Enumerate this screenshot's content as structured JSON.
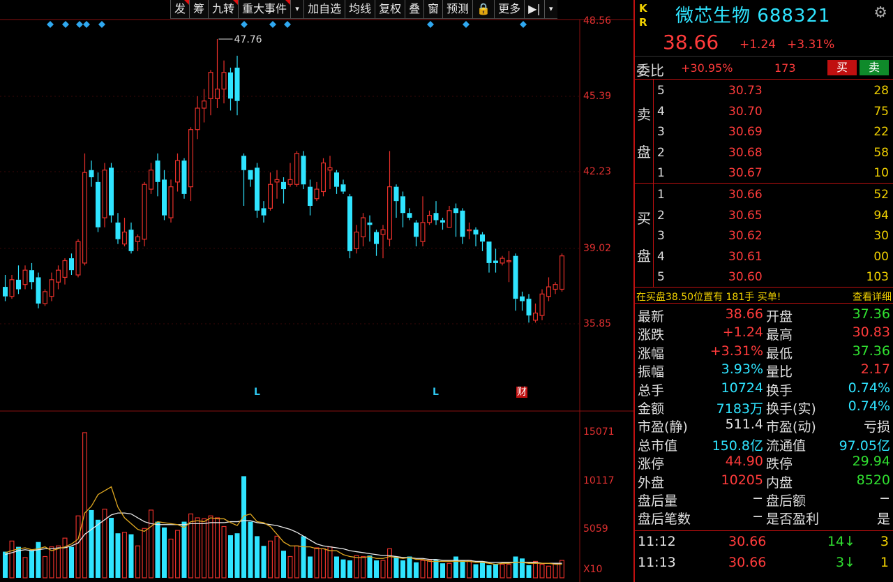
{
  "toolbar": {
    "items": [
      "发",
      "筹",
      "九转",
      "重大事件",
      "▾",
      "加自选",
      "均线",
      "复权",
      "叠",
      "窗",
      "预测",
      "🔒",
      "更多",
      "▶|",
      "▾"
    ]
  },
  "price_axis": [
    "48.56",
    "45.39",
    "42.23",
    "39.02",
    "35.85"
  ],
  "volume_axis": [
    "15071",
    "10117",
    "5059",
    "X10"
  ],
  "high_marker": "47.76",
  "event_marks": {
    "l1": "L",
    "l2": "L",
    "cai": "财"
  },
  "colors": {
    "up": "#e8302a",
    "down": "#2fe4ff",
    "ma_white": "#e8e8e8",
    "ma_yellow": "#e0a820",
    "grid": "#8a1010"
  },
  "chart_data": {
    "type": "candlestick",
    "candles": [
      [
        37.4,
        37.0,
        37.9,
        36.8
      ],
      [
        37.0,
        37.7,
        37.9,
        36.9
      ],
      [
        37.7,
        37.3,
        38.3,
        37.1
      ],
      [
        37.5,
        38.1,
        38.3,
        37.3
      ],
      [
        38.1,
        37.6,
        38.4,
        37.3
      ],
      [
        37.8,
        36.7,
        38.0,
        36.5
      ],
      [
        36.7,
        37.2,
        37.3,
        36.6
      ],
      [
        37.0,
        37.7,
        38.0,
        36.8
      ],
      [
        37.6,
        38.1,
        38.3,
        37.3
      ],
      [
        37.8,
        38.5,
        38.6,
        37.5
      ],
      [
        38.6,
        38.1,
        38.8,
        37.9
      ],
      [
        37.9,
        39.3,
        39.4,
        37.8
      ],
      [
        38.4,
        42.2,
        43.0,
        38.3
      ],
      [
        42.3,
        42.0,
        42.7,
        41.6
      ],
      [
        41.8,
        39.9,
        42.2,
        39.7
      ],
      [
        40.3,
        42.3,
        42.6,
        39.9
      ],
      [
        42.4,
        40.4,
        42.6,
        40.1
      ],
      [
        40.1,
        39.4,
        40.5,
        39.2
      ],
      [
        39.2,
        39.7,
        40.3,
        39.1
      ],
      [
        39.8,
        38.9,
        40.1,
        38.8
      ],
      [
        39.3,
        39.5,
        39.6,
        38.9
      ],
      [
        39.4,
        41.7,
        41.8,
        39.1
      ],
      [
        41.5,
        42.3,
        42.6,
        41.3
      ],
      [
        42.7,
        41.8,
        43.0,
        41.2
      ],
      [
        41.9,
        40.4,
        42.3,
        40.2
      ],
      [
        40.3,
        41.6,
        41.9,
        40.1
      ],
      [
        41.8,
        42.7,
        43.0,
        41.4
      ],
      [
        42.7,
        41.3,
        42.8,
        41.1
      ],
      [
        41.6,
        44.0,
        44.1,
        41.0
      ],
      [
        44.0,
        44.9,
        45.4,
        43.6
      ],
      [
        44.9,
        45.2,
        45.7,
        44.3
      ],
      [
        45.3,
        46.4,
        46.5,
        44.6
      ],
      [
        45.3,
        45.7,
        47.8,
        44.9
      ],
      [
        45.7,
        46.4,
        46.9,
        45.1
      ],
      [
        46.4,
        45.3,
        46.6,
        44.8
      ],
      [
        46.6,
        45.2,
        47.1,
        44.6
      ],
      [
        42.9,
        42.3,
        43.0,
        40.8
      ],
      [
        42.3,
        41.9,
        42.3,
        41.6
      ],
      [
        42.4,
        40.6,
        42.6,
        40.3
      ],
      [
        40.7,
        40.4,
        41.0,
        40.1
      ],
      [
        40.7,
        41.7,
        42.2,
        40.6
      ],
      [
        41.8,
        41.9,
        42.3,
        41.1
      ],
      [
        41.8,
        41.5,
        42.0,
        40.9
      ],
      [
        41.7,
        41.9,
        42.6,
        41.6
      ],
      [
        41.7,
        43.0,
        43.1,
        41.6
      ],
      [
        42.9,
        41.7,
        43.1,
        41.5
      ],
      [
        41.6,
        40.8,
        41.9,
        40.4
      ],
      [
        41.1,
        41.5,
        41.8,
        41.0
      ],
      [
        41.4,
        42.6,
        42.8,
        41.2
      ],
      [
        42.3,
        42.4,
        42.9,
        41.5
      ],
      [
        42.2,
        41.6,
        42.3,
        41.3
      ],
      [
        41.7,
        41.4,
        41.9,
        41.3
      ],
      [
        41.2,
        38.9,
        41.3,
        38.6
      ],
      [
        39.0,
        39.7,
        40.0,
        38.8
      ],
      [
        39.5,
        40.3,
        40.5,
        39.1
      ],
      [
        40.1,
        40.0,
        40.4,
        39.3
      ],
      [
        39.7,
        39.2,
        39.8,
        38.7
      ],
      [
        39.6,
        39.8,
        40.0,
        38.6
      ],
      [
        39.4,
        41.6,
        43.1,
        39.1
      ],
      [
        41.6,
        41.0,
        41.7,
        40.3
      ],
      [
        41.2,
        40.5,
        41.4,
        39.9
      ],
      [
        40.5,
        40.3,
        40.7,
        40.2
      ],
      [
        40.1,
        39.5,
        40.2,
        39.1
      ],
      [
        39.3,
        40.1,
        41.2,
        39.1
      ],
      [
        40.1,
        40.4,
        40.6,
        40.0
      ],
      [
        40.5,
        40.2,
        41.0,
        40.0
      ],
      [
        40.2,
        40.1,
        40.3,
        39.8
      ],
      [
        39.9,
        40.6,
        40.8,
        39.9
      ],
      [
        40.7,
        40.5,
        40.9,
        39.5
      ],
      [
        40.6,
        39.5,
        40.7,
        39.2
      ],
      [
        39.8,
        39.8,
        40.1,
        39.4
      ],
      [
        39.8,
        39.6,
        39.9,
        39.1
      ],
      [
        39.6,
        39.3,
        39.7,
        38.9
      ],
      [
        39.3,
        38.4,
        39.3,
        38.0
      ],
      [
        38.5,
        38.4,
        39.0,
        38.0
      ],
      [
        38.4,
        38.6,
        38.7,
        38.3
      ],
      [
        38.5,
        38.5,
        38.9,
        37.6
      ],
      [
        38.7,
        36.9,
        38.8,
        36.4
      ],
      [
        37.0,
        36.8,
        37.2,
        36.4
      ],
      [
        36.9,
        36.2,
        37.1,
        35.9
      ],
      [
        36.0,
        36.3,
        36.7,
        35.9
      ],
      [
        36.2,
        37.1,
        37.3,
        36.0
      ],
      [
        37.0,
        37.4,
        37.8,
        36.8
      ],
      [
        37.3,
        37.5,
        37.6,
        37.1
      ],
      [
        37.3,
        38.7,
        38.8,
        37.2
      ]
    ],
    "volumes": [
      27,
      38,
      32,
      21,
      28,
      37,
      22,
      32,
      33,
      41,
      32,
      64,
      150,
      70,
      60,
      71,
      62,
      46,
      47,
      45,
      33,
      51,
      70,
      58,
      52,
      40,
      49,
      58,
      66,
      62,
      61,
      64,
      62,
      53,
      44,
      46,
      105,
      58,
      43,
      33,
      38,
      43,
      28,
      22,
      33,
      43,
      22,
      31,
      30,
      32,
      22,
      19,
      18,
      23,
      22,
      23,
      18,
      18,
      30,
      22,
      18,
      22,
      16,
      18,
      18,
      19,
      15,
      15,
      22,
      18,
      18,
      14,
      17,
      13,
      14,
      14,
      14,
      22,
      20,
      13,
      17,
      14,
      12,
      15,
      18
    ],
    "ma5": [
      26,
      28,
      30,
      31,
      29,
      30,
      32,
      28,
      30,
      32,
      35,
      40,
      67,
      74,
      86,
      90,
      94,
      73,
      62,
      56,
      50,
      48,
      53,
      58,
      57,
      56,
      55,
      52,
      58,
      59,
      58,
      62,
      61,
      61,
      57,
      54,
      64,
      66,
      58,
      57,
      53,
      45,
      37,
      33,
      33,
      32,
      32,
      30,
      30,
      28,
      28,
      24,
      22,
      21,
      21,
      22,
      20,
      20,
      22,
      21,
      20,
      21,
      19,
      19,
      17,
      17,
      17,
      17,
      17,
      17,
      17,
      16,
      16,
      15,
      14,
      15,
      15,
      16,
      16,
      15,
      15,
      15,
      15,
      14,
      14
    ],
    "ma10": [
      24,
      26,
      28,
      29,
      28,
      29,
      30,
      30,
      31,
      31,
      33,
      36,
      45,
      50,
      55,
      60,
      65,
      67,
      67,
      66,
      62,
      58,
      56,
      55,
      55,
      55,
      55,
      55,
      56,
      56,
      56,
      57,
      57,
      57,
      58,
      58,
      59,
      59,
      57,
      56,
      55,
      54,
      52,
      50,
      47,
      43,
      39,
      35,
      33,
      32,
      31,
      30,
      28,
      27,
      26,
      25,
      24,
      23,
      23,
      22,
      21,
      21,
      20,
      20,
      19,
      19,
      18,
      18,
      18,
      18,
      18,
      17,
      17,
      16,
      16,
      16,
      16,
      16,
      16,
      16,
      16,
      15,
      15,
      15,
      15
    ]
  },
  "stock": {
    "kr": "K\nR",
    "name": "微芯生物",
    "code": "688321",
    "price": "38.66",
    "change": "+1.24",
    "change_pct": "+3.31%"
  },
  "weibi": {
    "label": "委比",
    "pct": "+30.95%",
    "num": "173",
    "buy": "买",
    "sell": "卖"
  },
  "orderbook": {
    "sell_label": [
      "卖",
      "盘"
    ],
    "buy_label": [
      "买",
      "盘"
    ],
    "sell": [
      {
        "lvl": "5",
        "price": "30.73",
        "qty": "28"
      },
      {
        "lvl": "4",
        "price": "30.70",
        "qty": "75"
      },
      {
        "lvl": "3",
        "price": "30.69",
        "qty": "22"
      },
      {
        "lvl": "2",
        "price": "30.68",
        "qty": "58"
      },
      {
        "lvl": "1",
        "price": "30.67",
        "qty": "10"
      }
    ],
    "buy": [
      {
        "lvl": "1",
        "price": "30.66",
        "qty": "52"
      },
      {
        "lvl": "2",
        "price": "30.65",
        "qty": "94"
      },
      {
        "lvl": "3",
        "price": "30.62",
        "qty": "30"
      },
      {
        "lvl": "4",
        "price": "30.61",
        "qty": "00"
      },
      {
        "lvl": "5",
        "price": "30.60",
        "qty": "103"
      }
    ]
  },
  "notice": {
    "text": "在买盘38.50位置有 181手 买单!",
    "link": "查看详细"
  },
  "quote": {
    "left": [
      {
        "label": "最新",
        "value": "38.66",
        "cls": "red"
      },
      {
        "label": "涨跌",
        "value": "+1.24",
        "cls": "red"
      },
      {
        "label": "涨幅",
        "value": "+3.31%",
        "cls": "red"
      },
      {
        "label": "振幅",
        "value": "3.93%",
        "cls": "cyan"
      },
      {
        "label": "总手",
        "value": "10724",
        "cls": "cyan"
      },
      {
        "label": "金额",
        "value": "7183万",
        "cls": "cyan"
      },
      {
        "label": "市盈(静)",
        "value": "511.4",
        "cls": "wht"
      },
      {
        "label": "总市值",
        "value": "150.8亿",
        "cls": "cyan"
      },
      {
        "label": "涨停",
        "value": "44.90",
        "cls": "red"
      },
      {
        "label": "外盘",
        "value": "10205",
        "cls": "red"
      },
      {
        "label": "盘后量",
        "value": "−",
        "cls": "wht"
      },
      {
        "label": "盘后笔数",
        "value": "−",
        "cls": "wht"
      }
    ],
    "right": [
      {
        "label": "开盘",
        "value": "37.36",
        "cls": "grn"
      },
      {
        "label": "最高",
        "value": "30.83",
        "cls": "red"
      },
      {
        "label": "最低",
        "value": "37.36",
        "cls": "grn"
      },
      {
        "label": "量比",
        "value": "2.17",
        "cls": "red"
      },
      {
        "label": "换手",
        "value": "0.74%",
        "cls": "cyan"
      },
      {
        "label": "换手(实)",
        "value": "0.74%",
        "cls": "cyan"
      },
      {
        "label": "市盈(动)",
        "value": "亏损",
        "cls": "wht"
      },
      {
        "label": "流通值",
        "value": "97.05亿",
        "cls": "cyan"
      },
      {
        "label": "跌停",
        "value": "29.94",
        "cls": "grn"
      },
      {
        "label": "内盘",
        "value": "8520",
        "cls": "grn"
      },
      {
        "label": "盘后额",
        "value": "−",
        "cls": "wht"
      },
      {
        "label": "是否盈利",
        "value": "是",
        "cls": "wht"
      }
    ]
  },
  "ticks": [
    {
      "time": "11:12",
      "price": "30.66",
      "vol": "14",
      "arrow": "↓",
      "count": "3"
    },
    {
      "time": "11:13",
      "price": "30.66",
      "vol": "3",
      "arrow": "↓",
      "count": "1"
    }
  ]
}
